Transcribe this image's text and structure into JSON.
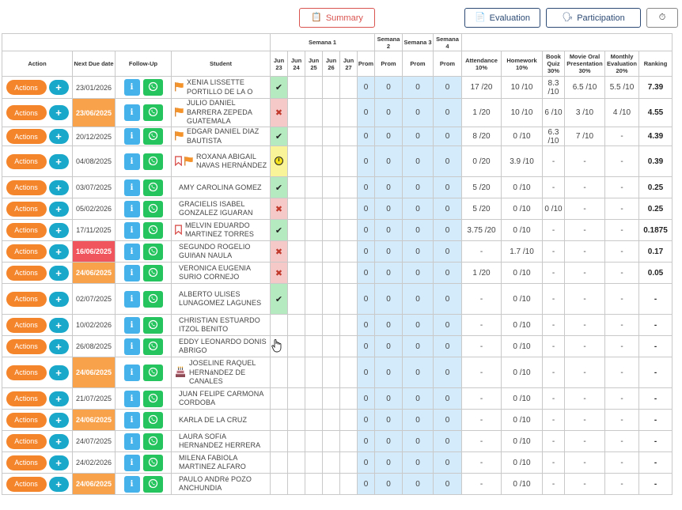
{
  "toolbar": {
    "summary_label": "Summary",
    "evaluation_label": "Evaluation",
    "participation_label": "Participation"
  },
  "colors": {
    "actions_orange": "#f5852b",
    "plus_teal": "#19a8c9",
    "info_blue": "#46b2ea",
    "whatsapp_green": "#25c45e",
    "due_orange": "#f8a24c",
    "due_red": "#f0545c",
    "present_green": "#b5eac0",
    "absent_red": "#f6c9c9",
    "late_yellow": "#f9f39a",
    "prom_blue": "#d4ebfb"
  },
  "table": {
    "headers": {
      "action": "Action",
      "next_due_date": "Next Due date",
      "follow_up": "Follow-Up",
      "student": "Student",
      "semana1": "Semana 1",
      "semana2": "Semana 2",
      "semana3": "Semana 3",
      "semana4": "Semana 4",
      "days": [
        "Jun 23",
        "Jun 24",
        "Jun 25",
        "Jun 26",
        "Jun 27"
      ],
      "prom": "Prom",
      "attendance": "Attendance 10%",
      "homework": "Homework 10%",
      "book_quiz": "Book Quiz 30%",
      "movie_oral": "Movie Oral Presentation 30%",
      "monthly": "Monthly Evaluation 20%",
      "ranking": "Ranking"
    },
    "actions_label": "Actions",
    "plus_label": "+",
    "info_label": "i",
    "rows": [
      {
        "due": "23/01/2026",
        "due_status": "normal",
        "icons": [
          "orange-flag"
        ],
        "student": "XENIA LISSETTE PORTILLO DE LA O",
        "att": "present",
        "prom1": "0",
        "prom2": "0",
        "prom3": "0",
        "prom4": "0",
        "attendance": "17 /20",
        "homework": "10 /10",
        "book_quiz": "8.3 /10",
        "movie_oral": "6.5 /10",
        "monthly": "5.5 /10",
        "ranking": "7.39"
      },
      {
        "due": "23/06/2025",
        "due_status": "orange",
        "icons": [
          "orange-flag"
        ],
        "student": "JULIO DANIEL BARRERA ZEPEDA GUATEMALA",
        "att": "absent",
        "prom1": "0",
        "prom2": "0",
        "prom3": "0",
        "prom4": "0",
        "attendance": "1 /20",
        "homework": "10 /10",
        "book_quiz": "6 /10",
        "movie_oral": "3 /10",
        "monthly": "4 /10",
        "ranking": "4.55"
      },
      {
        "due": "20/12/2025",
        "due_status": "normal",
        "icons": [
          "orange-flag"
        ],
        "student": "EDGAR DANIEL DIAZ BAUTISTA",
        "att": "present",
        "prom1": "0",
        "prom2": "0",
        "prom3": "0",
        "prom4": "0",
        "attendance": "8 /20",
        "homework": "0 /10",
        "book_quiz": "6.3 /10",
        "movie_oral": "7 /10",
        "monthly": "-",
        "ranking": "4.39"
      },
      {
        "due": "04/08/2025",
        "due_status": "normal",
        "icons": [
          "red-bookmark",
          "orange-flag"
        ],
        "student": "ROXANA ABIGAIL NAVAS HERNÁNDEZ",
        "att": "late",
        "prom1": "0",
        "prom2": "0",
        "prom3": "0",
        "prom4": "0",
        "attendance": "0 /20",
        "homework": "3.9 /10",
        "book_quiz": "-",
        "movie_oral": "-",
        "monthly": "-",
        "ranking": "0.39"
      },
      {
        "due": "03/07/2025",
        "due_status": "normal",
        "icons": [],
        "student": "AMY CAROLINA GOMEZ",
        "att": "present",
        "prom1": "0",
        "prom2": "0",
        "prom3": "0",
        "prom4": "0",
        "attendance": "5 /20",
        "homework": "0 /10",
        "book_quiz": "-",
        "movie_oral": "-",
        "monthly": "-",
        "ranking": "0.25"
      },
      {
        "due": "05/02/2026",
        "due_status": "normal",
        "icons": [],
        "student": "GRACIELIS ISABEL GONZALEZ IGUARAN",
        "att": "absent",
        "prom1": "0",
        "prom2": "0",
        "prom3": "0",
        "prom4": "0",
        "attendance": "5 /20",
        "homework": "0 /10",
        "book_quiz": "0 /10",
        "movie_oral": "-",
        "monthly": "-",
        "ranking": "0.25"
      },
      {
        "due": "17/11/2025",
        "due_status": "normal",
        "icons": [
          "red-bookmark"
        ],
        "student": "MELVIN EDUARDO MARTINEZ TORRES",
        "att": "present",
        "prom1": "0",
        "prom2": "0",
        "prom3": "0",
        "prom4": "0",
        "attendance": "3.75 /20",
        "homework": "0 /10",
        "book_quiz": "-",
        "movie_oral": "-",
        "monthly": "-",
        "ranking": "0.1875"
      },
      {
        "due": "16/06/2025",
        "due_status": "red",
        "icons": [],
        "student": "SEGUNDO ROGELIO GUIñAN NAULA",
        "att": "absent",
        "prom1": "0",
        "prom2": "0",
        "prom3": "0",
        "prom4": "0",
        "attendance": "-",
        "homework": "1.7 /10",
        "book_quiz": "-",
        "movie_oral": "-",
        "monthly": "-",
        "ranking": "0.17"
      },
      {
        "due": "24/06/2025",
        "due_status": "orange",
        "icons": [],
        "student": "VERONICA EUGENIA SURIO CORNEJO",
        "att": "absent",
        "prom1": "0",
        "prom2": "0",
        "prom3": "0",
        "prom4": "0",
        "attendance": "1 /20",
        "homework": "0 /10",
        "book_quiz": "-",
        "movie_oral": "-",
        "monthly": "-",
        "ranking": "0.05"
      },
      {
        "due": "02/07/2025",
        "due_status": "normal",
        "icons": [],
        "student": "ALBERTO ULISES LUNAGOMEZ LAGUNES",
        "att": "present",
        "prom1": "0",
        "prom2": "0",
        "prom3": "0",
        "prom4": "0",
        "attendance": "-",
        "homework": "0 /10",
        "book_quiz": "-",
        "movie_oral": "-",
        "monthly": "-",
        "ranking": "-"
      },
      {
        "due": "10/02/2026",
        "due_status": "normal",
        "icons": [],
        "student": "CHRISTIAN ESTUARDO ITZOL BENITO",
        "att": "none",
        "prom1": "0",
        "prom2": "0",
        "prom3": "0",
        "prom4": "0",
        "attendance": "-",
        "homework": "0 /10",
        "book_quiz": "-",
        "movie_oral": "-",
        "monthly": "-",
        "ranking": "-"
      },
      {
        "due": "26/08/2025",
        "due_status": "normal",
        "icons": [],
        "student": "EDDY LEONARDO DONIS ABRIGO",
        "att": "none",
        "prom1": "0",
        "prom2": "0",
        "prom3": "0",
        "prom4": "0",
        "attendance": "-",
        "homework": "0 /10",
        "book_quiz": "-",
        "movie_oral": "-",
        "monthly": "-",
        "ranking": "-"
      },
      {
        "due": "24/06/2025",
        "due_status": "orange",
        "icons": [
          "birthday-cake"
        ],
        "student": "JOSELINE RAQUEL HERNáNDEZ DE CANALES",
        "att": "none",
        "prom1": "0",
        "prom2": "0",
        "prom3": "0",
        "prom4": "0",
        "attendance": "-",
        "homework": "0 /10",
        "book_quiz": "-",
        "movie_oral": "-",
        "monthly": "-",
        "ranking": "-"
      },
      {
        "due": "21/07/2025",
        "due_status": "normal",
        "icons": [],
        "student": "JUAN FELIPE CARMONA CORDOBA",
        "att": "none",
        "prom1": "0",
        "prom2": "0",
        "prom3": "0",
        "prom4": "0",
        "attendance": "-",
        "homework": "0 /10",
        "book_quiz": "-",
        "movie_oral": "-",
        "monthly": "-",
        "ranking": "-"
      },
      {
        "due": "24/06/2025",
        "due_status": "orange",
        "icons": [],
        "student": "KARLA DE LA CRUZ",
        "att": "none",
        "prom1": "0",
        "prom2": "0",
        "prom3": "0",
        "prom4": "0",
        "attendance": "-",
        "homework": "0 /10",
        "book_quiz": "-",
        "movie_oral": "-",
        "monthly": "-",
        "ranking": "-"
      },
      {
        "due": "24/07/2025",
        "due_status": "normal",
        "icons": [],
        "student": "LAURA SOFíA HERNáNDEZ HERRERA",
        "att": "none",
        "prom1": "0",
        "prom2": "0",
        "prom3": "0",
        "prom4": "0",
        "attendance": "-",
        "homework": "0 /10",
        "book_quiz": "-",
        "movie_oral": "-",
        "monthly": "-",
        "ranking": "-"
      },
      {
        "due": "24/02/2026",
        "due_status": "normal",
        "icons": [],
        "student": "MILENA FABIOLA MARTINEZ ALFARO",
        "att": "none",
        "prom1": "0",
        "prom2": "0",
        "prom3": "0",
        "prom4": "0",
        "attendance": "-",
        "homework": "0 /10",
        "book_quiz": "-",
        "movie_oral": "-",
        "monthly": "-",
        "ranking": "-"
      },
      {
        "due": "24/06/2025",
        "due_status": "orange",
        "icons": [],
        "student": "PAULO ANDRé POZO ANCHUNDIA",
        "att": "none",
        "prom1": "0",
        "prom2": "0",
        "prom3": "0",
        "prom4": "0",
        "attendance": "-",
        "homework": "0 /10",
        "book_quiz": "-",
        "movie_oral": "-",
        "monthly": "-",
        "ranking": "-"
      }
    ]
  }
}
